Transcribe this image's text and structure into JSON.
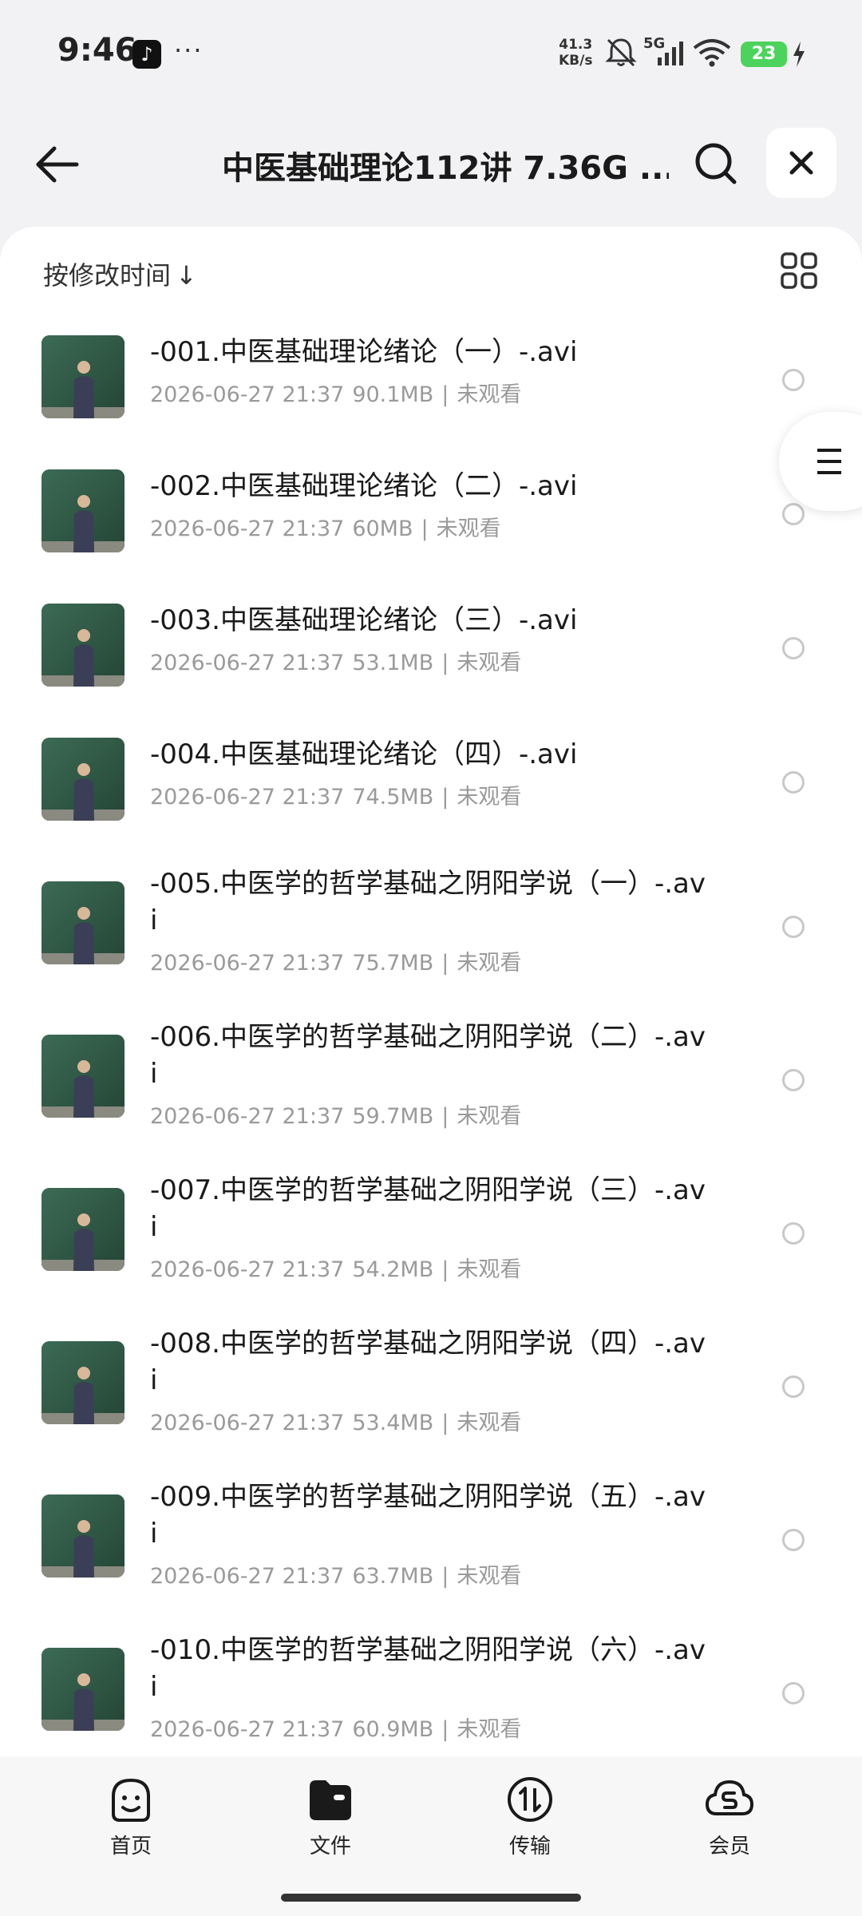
{
  "status": {
    "time": "9:46",
    "tiktok_glyph": "♪",
    "dots": "···",
    "net_speed_value": "41.3",
    "net_speed_unit": "KB/s",
    "network": "5G",
    "battery": "23"
  },
  "header": {
    "title": "中医基础理论112讲 7.36G ...",
    "icons": [
      "back-arrow-icon",
      "search-icon",
      "close-icon"
    ]
  },
  "toolbar": {
    "sort_label": "按修改时间",
    "sort_arrow": "↓",
    "view_toggle_icon": "grid-view-icon"
  },
  "files": [
    {
      "name": "-001.中医基础理论绪论（一）-.avi",
      "date": "2026-06-27 21:37",
      "size": "90.1MB",
      "sep": "|",
      "status": "未观看"
    },
    {
      "name": "-002.中医基础理论绪论（二）-.avi",
      "date": "2026-06-27 21:37",
      "size": "60MB",
      "sep": "|",
      "status": "未观看"
    },
    {
      "name": "-003.中医基础理论绪论（三）-.avi",
      "date": "2026-06-27 21:37",
      "size": "53.1MB",
      "sep": "|",
      "status": "未观看"
    },
    {
      "name": "-004.中医基础理论绪论（四）-.avi",
      "date": "2026-06-27 21:37",
      "size": "74.5MB",
      "sep": "|",
      "status": "未观看"
    },
    {
      "name": "-005.中医学的哲学基础之阴阳学说（一）-.avi",
      "date": "2026-06-27 21:37",
      "size": "75.7MB",
      "sep": "|",
      "status": "未观看"
    },
    {
      "name": "-006.中医学的哲学基础之阴阳学说（二）-.avi",
      "date": "2026-06-27 21:37",
      "size": "59.7MB",
      "sep": "|",
      "status": "未观看"
    },
    {
      "name": "-007.中医学的哲学基础之阴阳学说（三）-.avi",
      "date": "2026-06-27 21:37",
      "size": "54.2MB",
      "sep": "|",
      "status": "未观看"
    },
    {
      "name": "-008.中医学的哲学基础之阴阳学说（四）-.avi",
      "date": "2026-06-27 21:37",
      "size": "53.4MB",
      "sep": "|",
      "status": "未观看"
    },
    {
      "name": "-009.中医学的哲学基础之阴阳学说（五）-.avi",
      "date": "2026-06-27 21:37",
      "size": "63.7MB",
      "sep": "|",
      "status": "未观看"
    },
    {
      "name": "-010.中医学的哲学基础之阴阳学说（六）-.avi",
      "date": "2026-06-27 21:37",
      "size": "60.9MB",
      "sep": "|",
      "status": "未观看"
    }
  ],
  "nav": {
    "items": [
      {
        "label": "首页",
        "icon": "smiley-home-icon"
      },
      {
        "label": "文件",
        "icon": "folder-icon"
      },
      {
        "label": "传输",
        "icon": "transfer-icon"
      },
      {
        "label": "会员",
        "icon": "cloud-member-icon"
      }
    ]
  }
}
